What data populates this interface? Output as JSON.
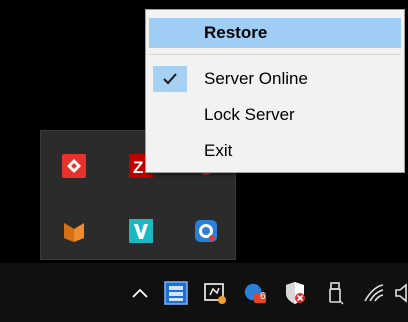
{
  "context_menu": {
    "items": [
      {
        "label": "Restore",
        "highlighted": true,
        "bold": true,
        "checked": false
      },
      {
        "label": "Server Online",
        "highlighted": false,
        "bold": false,
        "checked": true
      },
      {
        "label": "Lock Server",
        "highlighted": false,
        "bold": false,
        "checked": false
      },
      {
        "label": "Exit",
        "highlighted": false,
        "bold": false,
        "checked": false
      }
    ]
  },
  "tray_flyout": {
    "icons": [
      {
        "name": "anydesk-icon",
        "color": "#e8312b"
      },
      {
        "name": "filezilla-icon",
        "color": "#bf0000"
      },
      {
        "name": "red-circle-app-icon",
        "color": "#d0242b"
      },
      {
        "name": "fox-app-icon",
        "color": "#f08a2a"
      },
      {
        "name": "v-app-icon",
        "color": "#1bb8c4"
      },
      {
        "name": "q-app-icon",
        "color": "#2a7fd9"
      }
    ]
  },
  "taskbar": {
    "icons": [
      "show-hidden-icons-chevron-icon",
      "network-server-icon",
      "remote-app-icon",
      "notification-app-icon",
      "security-shield-icon",
      "usb-drive-icon",
      "wifi-icon",
      "speaker-icon"
    ],
    "badge_text": "6"
  },
  "colors": {
    "menu_highlight": "#9fcdf3",
    "menu_background": "#f2f2f2",
    "taskbar": "#101010",
    "flyout": "#2b2b2b"
  }
}
